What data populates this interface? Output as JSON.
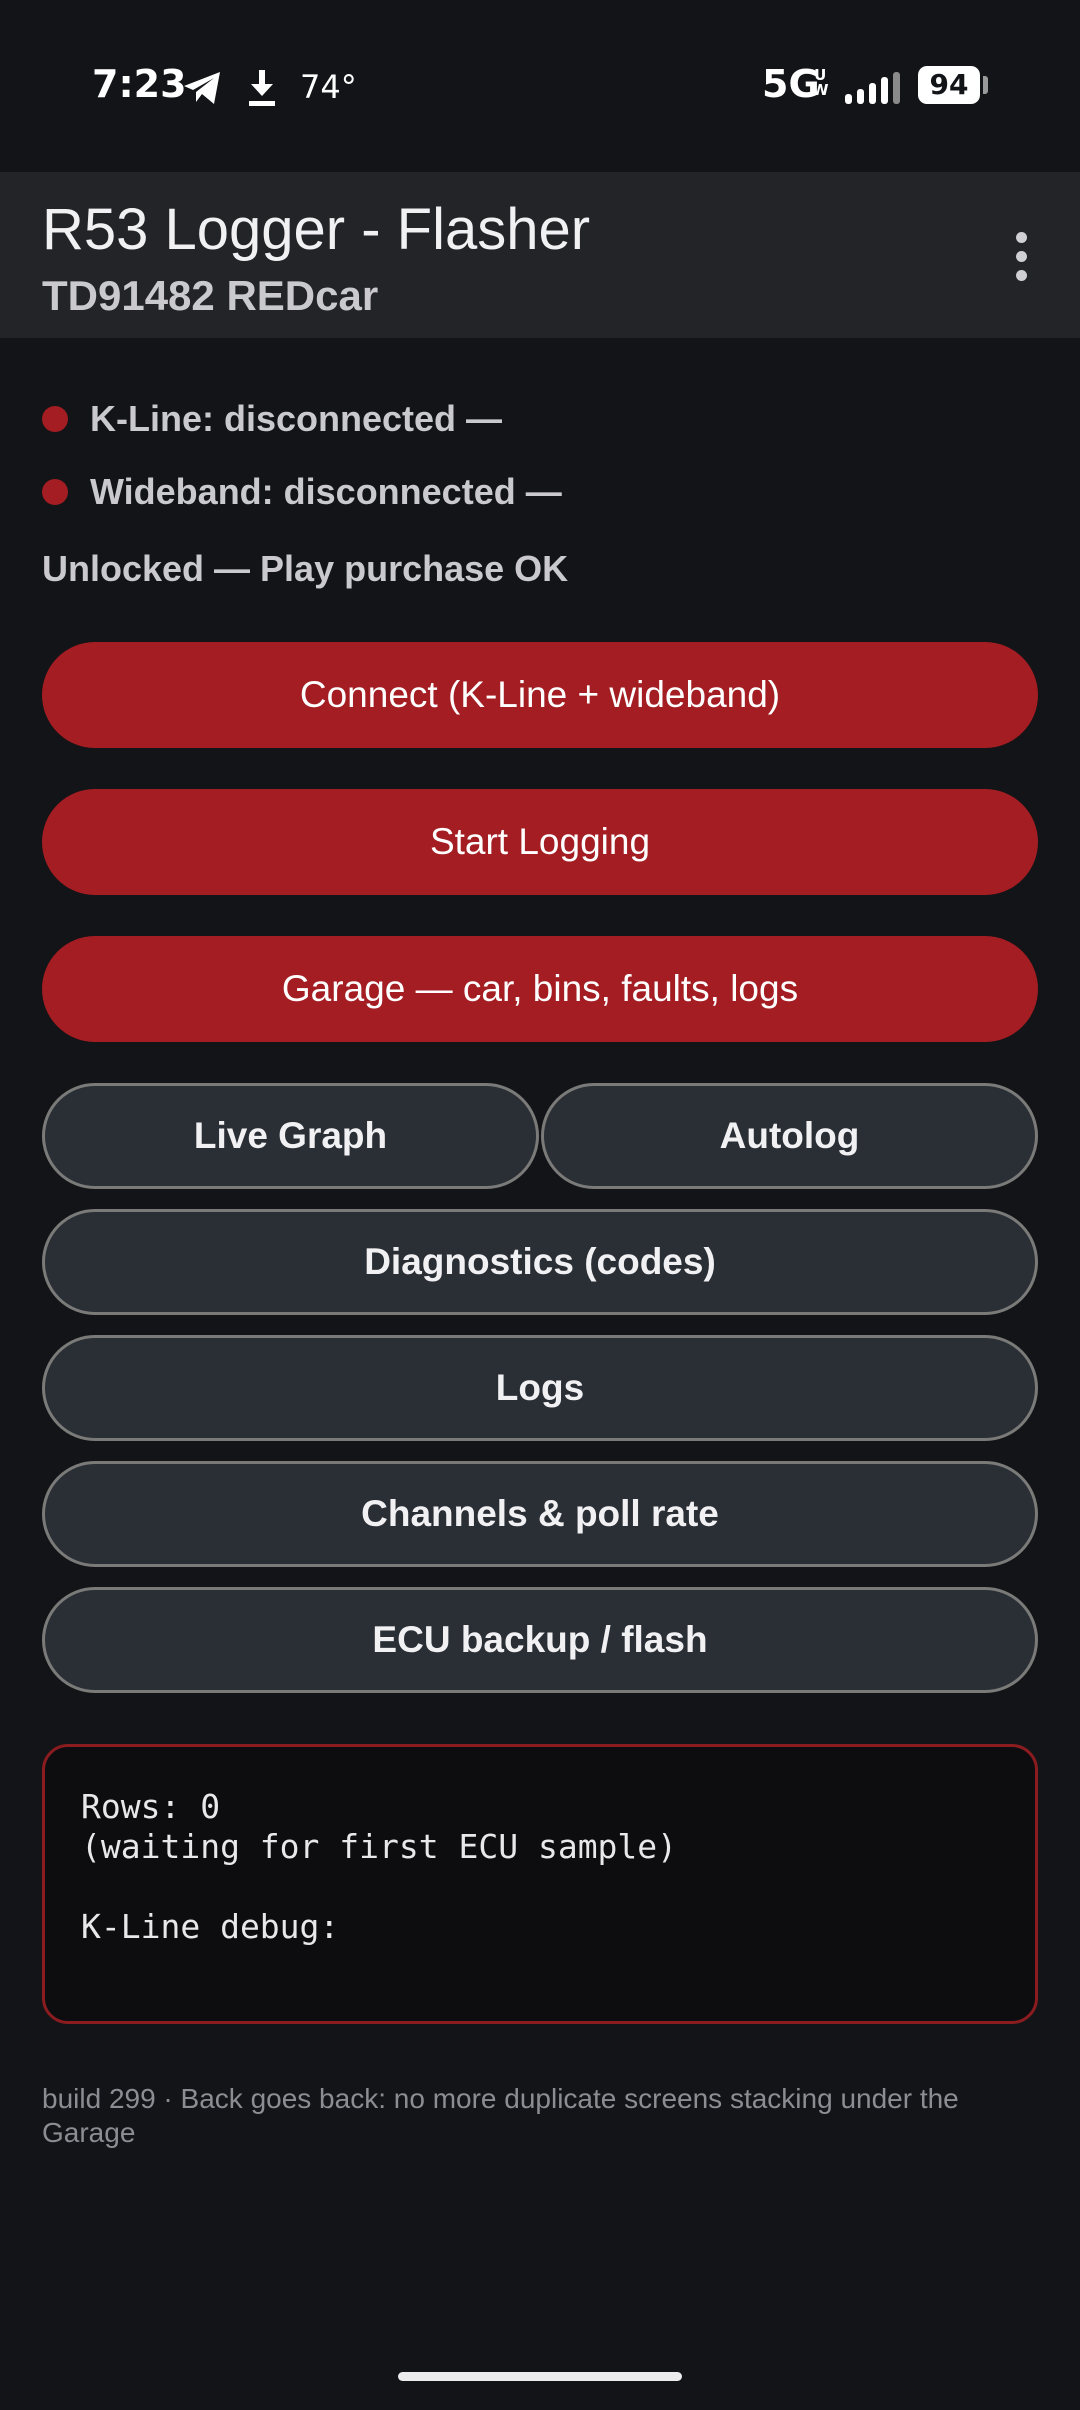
{
  "status_bar": {
    "time": "7:23",
    "temperature": "74°",
    "network": "5G",
    "network_sub": "UW",
    "battery": "94",
    "icons": [
      "telegram-icon",
      "download-icon",
      "signal-icon",
      "battery-icon"
    ]
  },
  "app_bar": {
    "title": "R53 Logger - Flasher",
    "subtitle": "TD91482 REDcar",
    "menu_icon": "more-vert-icon"
  },
  "status": {
    "kline": "K-Line: disconnected —",
    "wideband": "Wideband: disconnected —",
    "unlock": "Unlocked — Play purchase OK",
    "dot_color": "#a31d22"
  },
  "primary_buttons": {
    "connect": "Connect (K-Line + wideband)",
    "start_logging": "Start Logging",
    "garage": "Garage — car, bins, faults, logs"
  },
  "secondary_buttons": {
    "live_graph": "Live Graph",
    "autolog": "Autolog",
    "diagnostics": "Diagnostics (codes)",
    "logs": "Logs",
    "channels": "Channels & poll rate",
    "ecu": "ECU backup / flash"
  },
  "console": {
    "line1": "Rows: 0",
    "line2": "(waiting for first ECU sample)",
    "line3": "",
    "line4": "K-Line debug:"
  },
  "footer": {
    "note": "build 299 · Back goes back: no more duplicate screens stacking under the Garage"
  },
  "colors": {
    "background": "#131417",
    "accent_red": "#a31d22",
    "app_bar": "#232428",
    "outline_button": "#2a2e35"
  }
}
